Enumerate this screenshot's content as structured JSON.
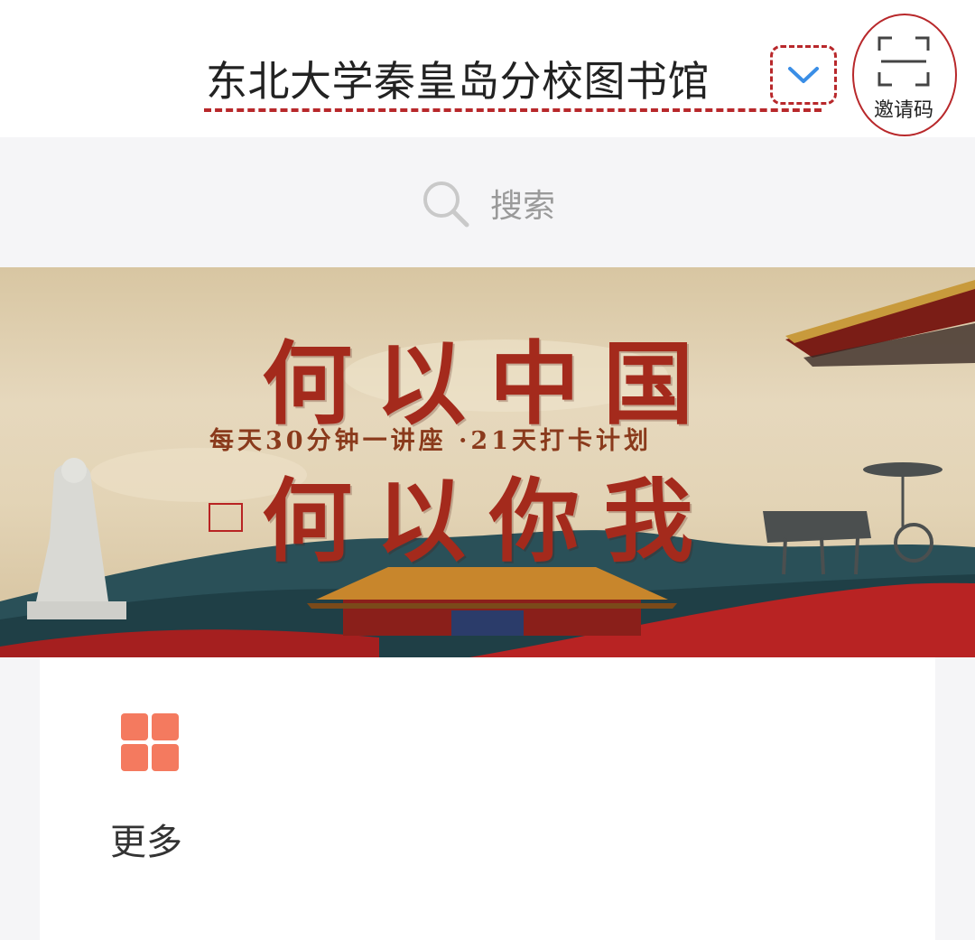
{
  "header": {
    "library_name": "东北大学秦皇岛分校图书馆",
    "invite_code_label": "邀请码"
  },
  "search": {
    "placeholder": "搜索"
  },
  "banner": {
    "title_line1": "何以中国",
    "subtitle": "每天30分钟一讲座 ·21天打卡计划",
    "title_line2": "何以你我"
  },
  "quick_links": [
    {
      "label": "更多",
      "icon": "grid-icon"
    }
  ],
  "colors": {
    "annotation_red": "#b8282b",
    "accent_blue": "#3a8ee6",
    "grid_icon": "#f47a5f"
  }
}
